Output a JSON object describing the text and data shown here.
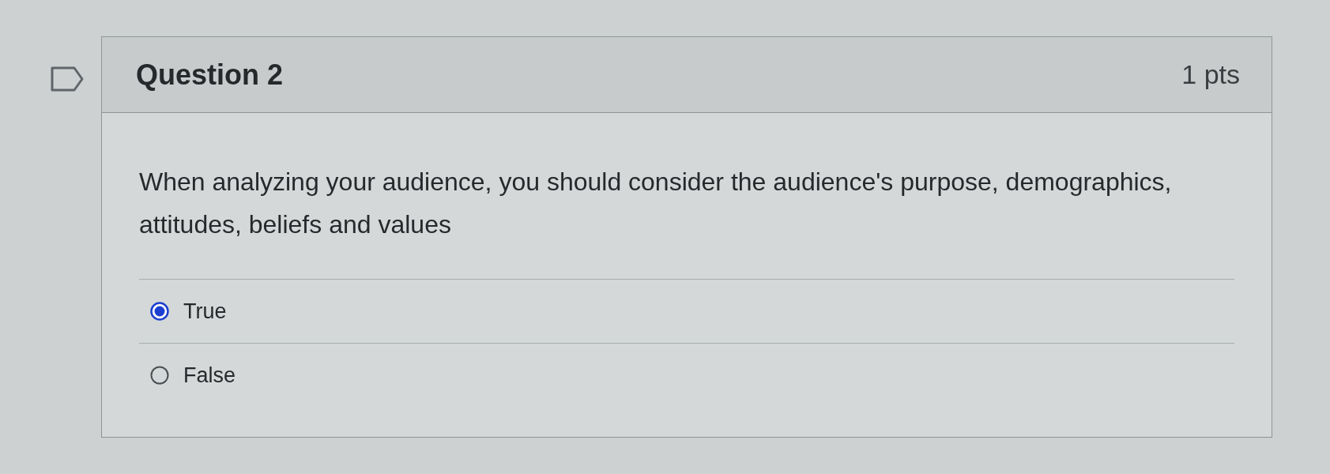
{
  "question": {
    "flagged": false,
    "title": "Question 2",
    "points": "1 pts",
    "text": "When analyzing your audience, you should consider the audience's purpose, demographics, attitudes, beliefs and values",
    "answers": [
      {
        "label": "True",
        "selected": true
      },
      {
        "label": "False",
        "selected": false
      }
    ]
  }
}
